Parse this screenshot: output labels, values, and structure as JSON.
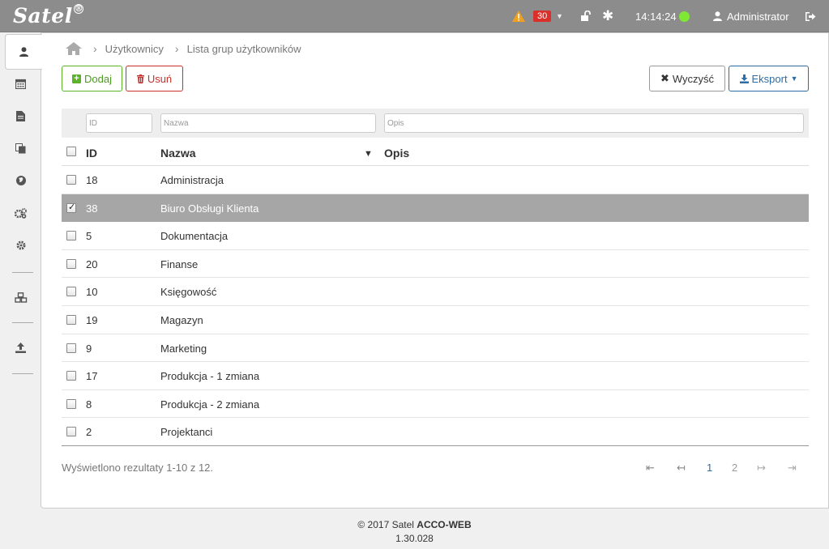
{
  "header": {
    "logo": "Satel",
    "logo_mark": "®",
    "alarm_count": "30",
    "time": "14:14:24",
    "user": "Administrator"
  },
  "breadcrumb": {
    "items": [
      "Użytkownicy",
      "Lista grup użytkowników"
    ]
  },
  "toolbar": {
    "add_label": "Dodaj",
    "delete_label": "Usuń",
    "clear_label": "Wyczyść",
    "export_label": "Eksport"
  },
  "filters": {
    "id_placeholder": "ID",
    "name_placeholder": "Nazwa",
    "desc_placeholder": "Opis"
  },
  "table": {
    "columns": [
      "ID",
      "Nazwa",
      "Opis"
    ],
    "sort_indicator": "▼",
    "rows": [
      {
        "id": "18",
        "name": "Administracja",
        "desc": "",
        "selected": false
      },
      {
        "id": "38",
        "name": "Biuro Obsługi Klienta",
        "desc": "",
        "selected": true
      },
      {
        "id": "5",
        "name": "Dokumentacja",
        "desc": "",
        "selected": false
      },
      {
        "id": "20",
        "name": "Finanse",
        "desc": "",
        "selected": false
      },
      {
        "id": "10",
        "name": "Księgowość",
        "desc": "",
        "selected": false
      },
      {
        "id": "19",
        "name": "Magazyn",
        "desc": "",
        "selected": false
      },
      {
        "id": "9",
        "name": "Marketing",
        "desc": "",
        "selected": false
      },
      {
        "id": "17",
        "name": "Produkcja - 1 zmiana",
        "desc": "",
        "selected": false
      },
      {
        "id": "8",
        "name": "Produkcja - 2 zmiana",
        "desc": "",
        "selected": false
      },
      {
        "id": "2",
        "name": "Projektanci",
        "desc": "",
        "selected": false
      }
    ]
  },
  "pagination": {
    "results_text": "Wyświetlono rezultaty 1-10 z 12.",
    "first": "⇤",
    "prev": "↤",
    "pages": [
      "1",
      "2"
    ],
    "next": "↦",
    "last": "⇥"
  },
  "footer": {
    "copyright": "© 2017 Satel",
    "product": "ACCO-WEB",
    "version": "1.30.028"
  },
  "colors": {
    "topbar": "#8c8c8c",
    "selected_row": "#a6a6a6",
    "add": "#5cb32a",
    "delete": "#c9302c",
    "export": "#2e6da4",
    "status": "#7ee832"
  }
}
